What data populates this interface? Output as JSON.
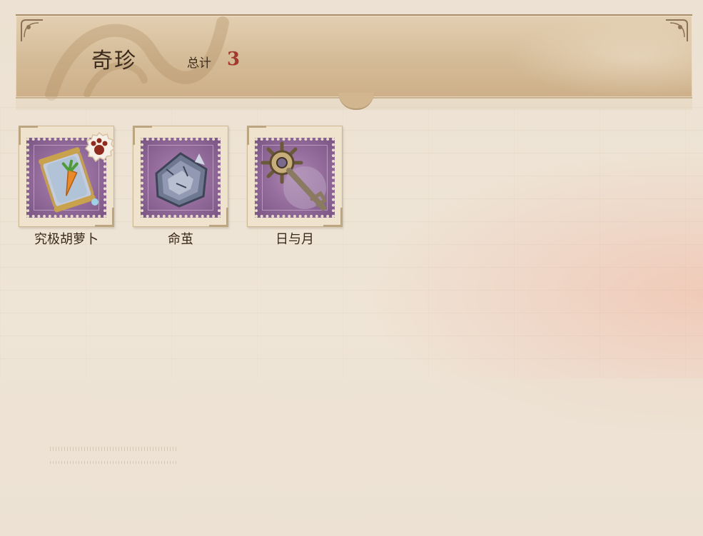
{
  "header": {
    "title": "奇珍",
    "total_label": "总计",
    "total_count": "3"
  },
  "items": [
    {
      "name": "究极胡萝卜",
      "icon": "carrot-jar-icon",
      "has_badge": true,
      "badge_icon": "paw-badge-icon"
    },
    {
      "name": "命茧",
      "icon": "silver-cocoon-icon",
      "has_badge": false
    },
    {
      "name": "日与月",
      "icon": "sun-key-icon",
      "has_badge": false
    }
  ],
  "colors": {
    "accent_count": "#a33a2e",
    "stamp_purple": "#98709f",
    "text_dark": "#3b2a1c"
  }
}
